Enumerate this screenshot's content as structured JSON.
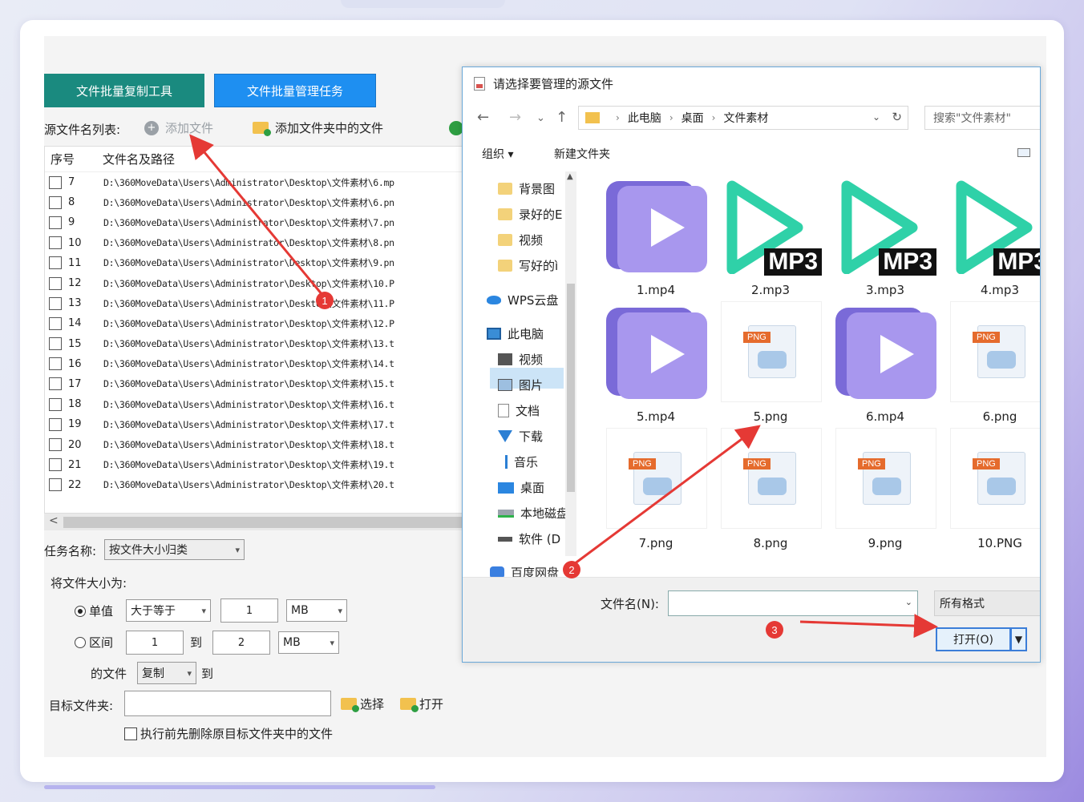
{
  "tool": {
    "btn_copy": "文件批量复制工具",
    "btn_manage": "文件批量管理任务",
    "src_list_label": "源文件名列表:",
    "add_file": "添加文件",
    "add_folder": "添加文件夹中的文件",
    "col_num": "序号",
    "col_path": "文件名及路径",
    "rows": [
      {
        "num": "7",
        "path": "D:\\360MoveData\\Users\\Administrator\\Desktop\\文件素材\\6.mp"
      },
      {
        "num": "8",
        "path": "D:\\360MoveData\\Users\\Administrator\\Desktop\\文件素材\\6.pn"
      },
      {
        "num": "9",
        "path": "D:\\360MoveData\\Users\\Administrator\\Desktop\\文件素材\\7.pn"
      },
      {
        "num": "10",
        "path": "D:\\360MoveData\\Users\\Administrator\\Desktop\\文件素材\\8.pn"
      },
      {
        "num": "11",
        "path": "D:\\360MoveData\\Users\\Administrator\\Desktop\\文件素材\\9.pn"
      },
      {
        "num": "12",
        "path": "D:\\360MoveData\\Users\\Administrator\\Desktop\\文件素材\\10.P"
      },
      {
        "num": "13",
        "path": "D:\\360MoveData\\Users\\Administrator\\Desktop\\文件素材\\11.P"
      },
      {
        "num": "14",
        "path": "D:\\360MoveData\\Users\\Administrator\\Desktop\\文件素材\\12.P"
      },
      {
        "num": "15",
        "path": "D:\\360MoveData\\Users\\Administrator\\Desktop\\文件素材\\13.t"
      },
      {
        "num": "16",
        "path": "D:\\360MoveData\\Users\\Administrator\\Desktop\\文件素材\\14.t"
      },
      {
        "num": "17",
        "path": "D:\\360MoveData\\Users\\Administrator\\Desktop\\文件素材\\15.t"
      },
      {
        "num": "18",
        "path": "D:\\360MoveData\\Users\\Administrator\\Desktop\\文件素材\\16.t"
      },
      {
        "num": "19",
        "path": "D:\\360MoveData\\Users\\Administrator\\Desktop\\文件素材\\17.t"
      },
      {
        "num": "20",
        "path": "D:\\360MoveData\\Users\\Administrator\\Desktop\\文件素材\\18.t"
      },
      {
        "num": "21",
        "path": "D:\\360MoveData\\Users\\Administrator\\Desktop\\文件素材\\19.t"
      },
      {
        "num": "22",
        "path": "D:\\360MoveData\\Users\\Administrator\\Desktop\\文件素材\\20.t"
      }
    ],
    "scroll_left": "<",
    "task_name_label": "任务名称:",
    "task_name_value": "按文件大小归类",
    "size_label": "将文件大小为:",
    "single_label": "单值",
    "single_op": "大于等于",
    "single_value": "1",
    "single_unit": "MB",
    "range_label": "区间",
    "range_from": "1",
    "to_label": "到",
    "range_to": "2",
    "range_unit": "MB",
    "file_label": "的文件",
    "action_value": "复制",
    "to_label2": "到",
    "target_label": "目标文件夹:",
    "choose": "选择",
    "open": "打开",
    "clear_option": "执行前先删除原目标文件夹中的文件"
  },
  "dialog": {
    "title": "请选择要管理的源文件",
    "back": "←",
    "forward": "→",
    "recent": "⌄",
    "up": "↑",
    "crumbs": [
      "此电脑",
      "桌面",
      "文件素材"
    ],
    "refresh": "↻",
    "search_placeholder": "搜索\"文件素材\"",
    "organize": "组织 ▾",
    "new_folder": "新建文件夹",
    "sidebar": [
      {
        "label": "背景图",
        "icon": "folder-icon"
      },
      {
        "label": "录好的E",
        "icon": "folder-icon"
      },
      {
        "label": "视频",
        "icon": "folder-icon"
      },
      {
        "label": "写好的ì",
        "icon": "folder-icon"
      },
      {
        "label": "WPS云盘",
        "icon": "cloud-icon"
      },
      {
        "label": "此电脑",
        "icon": "computer-icon"
      },
      {
        "label": "视频",
        "icon": "video-icon"
      },
      {
        "label": "图片",
        "icon": "picture-icon"
      },
      {
        "label": "文档",
        "icon": "document-icon"
      },
      {
        "label": "下载",
        "icon": "download-icon"
      },
      {
        "label": "音乐",
        "icon": "music-icon"
      },
      {
        "label": "桌面",
        "icon": "desktop-icon"
      },
      {
        "label": "本地磁盘",
        "icon": "disk-icon"
      },
      {
        "label": "软件 (D",
        "icon": "drive-icon"
      },
      {
        "label": "百度网盘",
        "icon": "baidu-netdisk-icon"
      }
    ],
    "files": [
      {
        "name": "1.mp4",
        "kind": "mp4"
      },
      {
        "name": "2.mp3",
        "kind": "mp3"
      },
      {
        "name": "3.mp3",
        "kind": "mp3"
      },
      {
        "name": "4.mp3",
        "kind": "mp3"
      },
      {
        "name": "5.mp4",
        "kind": "mp4"
      },
      {
        "name": "5.png",
        "kind": "png"
      },
      {
        "name": "6.mp4",
        "kind": "mp4"
      },
      {
        "name": "6.png",
        "kind": "png"
      },
      {
        "name": "7.png",
        "kind": "png"
      },
      {
        "name": "8.png",
        "kind": "png"
      },
      {
        "name": "9.png",
        "kind": "png"
      },
      {
        "name": "10.PNG",
        "kind": "png"
      }
    ],
    "mp3_tag": "MP3",
    "png_tag": "PNG",
    "filename_label": "文件名(N):",
    "filetype": "所有格式",
    "open_button": "打开(O)",
    "open_split": "▼"
  },
  "annotations": [
    "1",
    "2",
    "3"
  ],
  "colors": {
    "green_button": "#1a8a7f",
    "blue_button": "#1e8ff1",
    "annotation_red": "#e53935",
    "mp3_teal": "#2fd1a8",
    "mp4_purple": "#a897ee"
  }
}
